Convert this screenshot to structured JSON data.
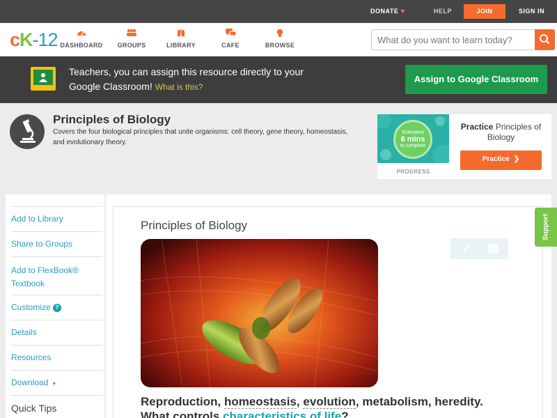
{
  "topbar": {
    "donate": "DONATE",
    "help": "HELP",
    "join": "JOIN",
    "signin": "SIGN IN"
  },
  "header": {
    "logo_c": "c",
    "logo_k": "K",
    "logo_n": "-12",
    "nav": [
      {
        "label": "DASHBOARD",
        "icon": "dashboard-gauge-icon"
      },
      {
        "label": "GROUPS",
        "icon": "groups-people-icon"
      },
      {
        "label": "LIBRARY",
        "icon": "library-book-icon"
      },
      {
        "label": "CAFE",
        "icon": "cafe-chat-icon"
      },
      {
        "label": "BROWSE",
        "icon": "browse-bulb-icon"
      }
    ],
    "search_placeholder": "What do you want to learn today?"
  },
  "gc_banner": {
    "text": "Teachers, you can assign this resource directly to your Google Classroom!",
    "what_link": "What is this?",
    "button": "Assign to Google Classroom"
  },
  "course": {
    "title": "Principles of Biology",
    "description": "Covers the four biological principles that unite organisms: cell theory, gene theory, homeostasis, and evolutionary theory."
  },
  "practice": {
    "estimated": "Estimated",
    "minutes": "6 mins",
    "to_complete": "to complete",
    "progress_label": "PROGRESS",
    "title_bold": "Practice",
    "title_rest": "Principles of Biology",
    "button": "Practice"
  },
  "sidebar": {
    "items": [
      "Add to Library",
      "Share to Groups",
      "Add to FlexBook® Textbook",
      "Customize",
      "Details",
      "Resources",
      "Download",
      "Quick Tips"
    ]
  },
  "article": {
    "title": "Principles of Biology",
    "para_w1": "Reproduction,",
    "para_l1": "homeostasis",
    "para_w2": ",",
    "para_l2": "evolution",
    "para_w3": ", metabolism, heredity.",
    "para_w4": "What controls",
    "para_l3": "characteristics of life",
    "para_w5": "?"
  },
  "support": "Support",
  "colors": {
    "accent_orange": "#f46b2d",
    "google_green": "#1e9a4e",
    "link_blue": "#2a9cc5",
    "support_green": "#7ac44a"
  }
}
